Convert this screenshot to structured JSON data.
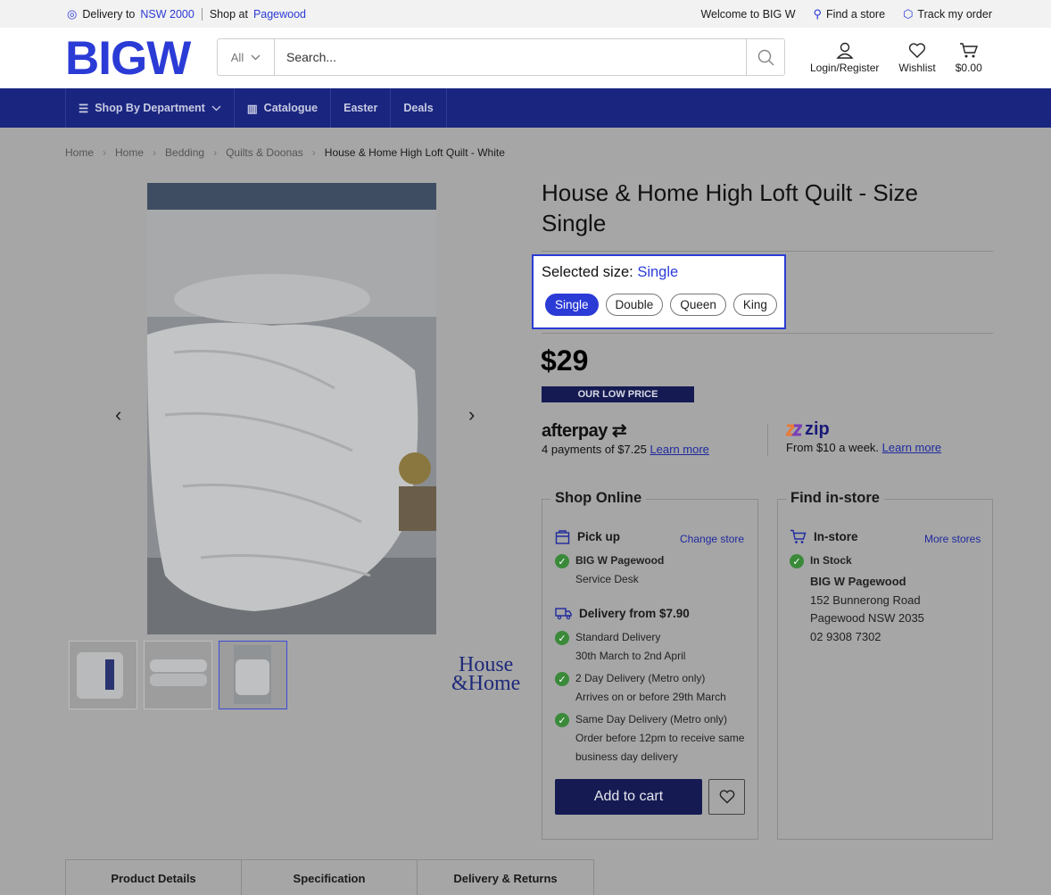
{
  "utility": {
    "delivery_prefix": "Delivery to",
    "delivery_location": "NSW 2000",
    "shop_prefix": "Shop at",
    "shop_store": "Pagewood",
    "welcome": "Welcome to BIG W",
    "find_store": "Find a store",
    "track_order": "Track my order"
  },
  "header": {
    "logo": "BIGW",
    "search_category": "All",
    "search_placeholder": "Search...",
    "login": "Login/Register",
    "wishlist": "Wishlist",
    "cart_total": "$0.00"
  },
  "nav": {
    "items": [
      "Shop By Department",
      "Catalogue",
      "Easter",
      "Deals"
    ]
  },
  "breadcrumb": [
    "Home",
    "Home",
    "Bedding",
    "Quilts & Doonas",
    "House & Home High Loft Quilt - White"
  ],
  "brand_logo": {
    "line1": "House",
    "line2": "&Home"
  },
  "product": {
    "title": "House & Home High Loft Quilt - Size Single",
    "size_label": "Selected size:",
    "selected_size": "Single",
    "sizes": [
      "Single",
      "Double",
      "Queen",
      "King"
    ],
    "price": "$29",
    "badge": "OUR LOW PRICE"
  },
  "payments": {
    "afterpay_brand": "afterpay",
    "afterpay_text": "4 payments of $7.25",
    "learn_more": "Learn more",
    "zip_brand": "zip",
    "zip_text": "From $10 a week."
  },
  "shop_online": {
    "legend": "Shop Online",
    "pickup_title": "Pick up",
    "change_store": "Change store",
    "pickup_store": "BIG W Pagewood",
    "pickup_location": "Service Desk",
    "delivery_title": "Delivery from $7.90",
    "options": [
      {
        "name": "Standard Delivery",
        "detail": "30th March to 2nd April"
      },
      {
        "name": "2 Day Delivery (Metro only)",
        "detail": "Arrives on or before 29th March"
      },
      {
        "name": "Same Day Delivery (Metro only)",
        "detail": "Order before 12pm to receive same",
        "detail2": "business day delivery"
      }
    ],
    "add_to_cart": "Add to cart"
  },
  "find_instore": {
    "legend": "Find in-store",
    "title": "In-store",
    "more_stores": "More stores",
    "stock": "In Stock",
    "store_name": "BIG W Pagewood",
    "address1": "152 Bunnerong Road",
    "address2": "Pagewood NSW 2035",
    "phone": "02 9308 7302"
  },
  "tabs": [
    "Product Details",
    "Specification",
    "Delivery & Returns"
  ]
}
